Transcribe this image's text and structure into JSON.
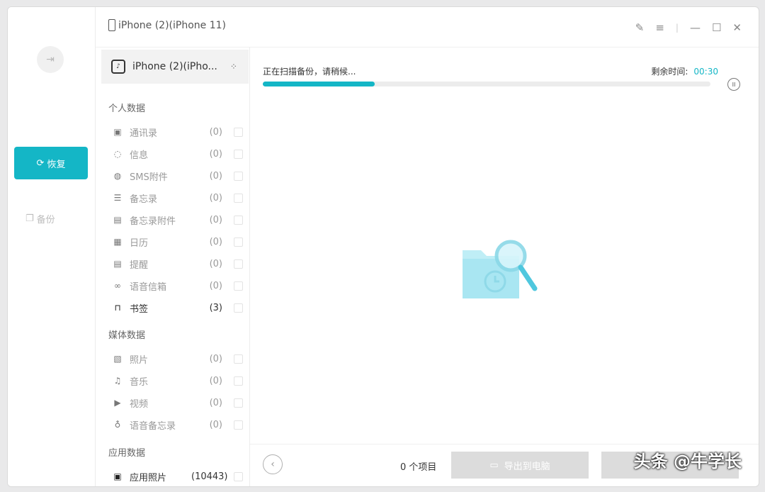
{
  "rail": {
    "restore_label": "恢复",
    "backup_label": "备份"
  },
  "header": {
    "device_title": "iPhone (2)(iPhone 11)"
  },
  "device": {
    "name": "iPhone (2)(iPho..."
  },
  "sections": {
    "personal": "个人数据",
    "media": "媒体数据",
    "app": "应用数据"
  },
  "personal_items": [
    {
      "label": "通讯录",
      "count": "(0)",
      "icon": "contacts-icon"
    },
    {
      "label": "信息",
      "count": "(0)",
      "icon": "message-icon"
    },
    {
      "label": "SMS附件",
      "count": "(0)",
      "icon": "sms-attachment-icon"
    },
    {
      "label": "备忘录",
      "count": "(0)",
      "icon": "notes-icon"
    },
    {
      "label": "备忘录附件",
      "count": "(0)",
      "icon": "notes-attachment-icon"
    },
    {
      "label": "日历",
      "count": "(0)",
      "icon": "calendar-icon"
    },
    {
      "label": "提醒",
      "count": "(0)",
      "icon": "reminder-icon"
    },
    {
      "label": "语音信箱",
      "count": "(0)",
      "icon": "voicemail-icon"
    },
    {
      "label": "书签",
      "count": "(3)",
      "icon": "bookmark-icon"
    }
  ],
  "media_items": [
    {
      "label": "照片",
      "count": "(0)",
      "icon": "photo-icon"
    },
    {
      "label": "音乐",
      "count": "(0)",
      "icon": "music-icon"
    },
    {
      "label": "视频",
      "count": "(0)",
      "icon": "video-icon"
    },
    {
      "label": "语音备忘录",
      "count": "(0)",
      "icon": "voice-memo-icon"
    }
  ],
  "app_items": [
    {
      "label": "应用照片",
      "count": "(10443)",
      "icon": "app-photo-icon"
    }
  ],
  "scan": {
    "status": "正在扫描备份，请稍候...",
    "remaining_label": "剩余时间:",
    "remaining_value": "00:30",
    "progress": 0.25
  },
  "footer": {
    "item_count": "0 个项目",
    "export_label": "导出到电脑"
  },
  "watermark": "头条 @牛学长",
  "colors": {
    "accent": "#14b6c6"
  }
}
